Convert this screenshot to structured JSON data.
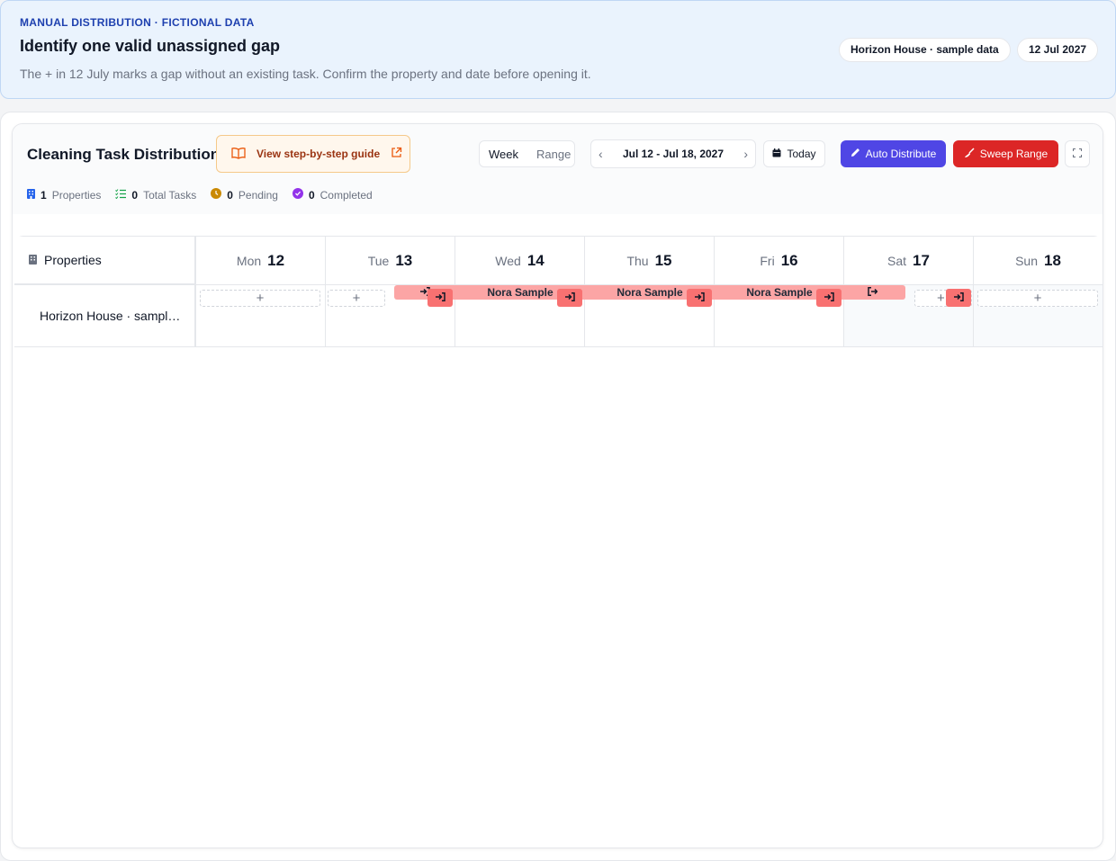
{
  "banner": {
    "eyebrow": "MANUAL DISTRIBUTION · FICTIONAL DATA",
    "heading": "Identify one valid unassigned gap",
    "description": "The + in 12 July marks a gap without an existing task. Confirm the property and date before opening it.",
    "pill_property": "Horizon House · sample data",
    "pill_date": "12 Jul 2027"
  },
  "toolbar": {
    "title": "Cleaning Task Distribution",
    "guide_label": "View step-by-step guide",
    "view_options": [
      "Week",
      "Range"
    ],
    "active_view": "Week",
    "date_range": "Jul 12 - Jul 18, 2027",
    "today_label": "Today",
    "auto_label": "Auto Distribute",
    "sweep_label": "Sweep Range"
  },
  "stats": {
    "properties_count": "1",
    "properties_label": "Properties",
    "tasks_count": "0",
    "tasks_label": "Total Tasks",
    "pending_count": "0",
    "pending_label": "Pending",
    "completed_count": "0",
    "completed_label": "Completed"
  },
  "grid": {
    "properties_header": "Properties",
    "days": [
      {
        "name": "Mon",
        "date": "12"
      },
      {
        "name": "Tue",
        "date": "13"
      },
      {
        "name": "Wed",
        "date": "14"
      },
      {
        "name": "Thu",
        "date": "15"
      },
      {
        "name": "Fri",
        "date": "16"
      },
      {
        "name": "Sat",
        "date": "17"
      },
      {
        "name": "Sun",
        "date": "18"
      }
    ],
    "property_name": "Horizon House · sampl…",
    "add_symbol": "+",
    "guest_name": "Nora Sample"
  },
  "colors": {
    "accent": "#4f46e5",
    "danger": "#dc2626",
    "booking": "#fca5a5",
    "badge": "#f87171"
  },
  "icons": [
    "book-icon",
    "external-link-icon",
    "calendar-icon",
    "pencil-icon",
    "broom-icon",
    "fullscreen-icon",
    "building-icon",
    "checklist-icon",
    "clock-icon",
    "check-circle-icon",
    "check-in-icon",
    "check-out-icon"
  ]
}
